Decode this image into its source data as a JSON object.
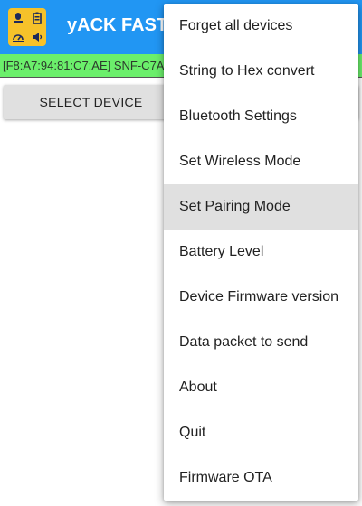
{
  "app_bar": {
    "title": "yACK FAST",
    "logo_icons": [
      "sensor-icon",
      "battery-icon",
      "gauge-icon",
      "speaker-icon"
    ],
    "color": "#2196f3"
  },
  "status_strip": {
    "text": "[F8:A7:94:81:C7:AE] SNF-C7A",
    "color": "#6bef6b"
  },
  "main": {
    "select_device_label": "SELECT DEVICE"
  },
  "menu": {
    "items": [
      {
        "label": "Forget all devices"
      },
      {
        "label": "String to Hex convert"
      },
      {
        "label": "Bluetooth Settings"
      },
      {
        "label": "Set Wireless Mode"
      },
      {
        "label": "Set Pairing Mode",
        "highlighted": true
      },
      {
        "label": "Battery Level"
      },
      {
        "label": "Device Firmware version"
      },
      {
        "label": "Data packet to send"
      },
      {
        "label": "About"
      },
      {
        "label": "Quit"
      },
      {
        "label": "Firmware OTA"
      }
    ]
  }
}
